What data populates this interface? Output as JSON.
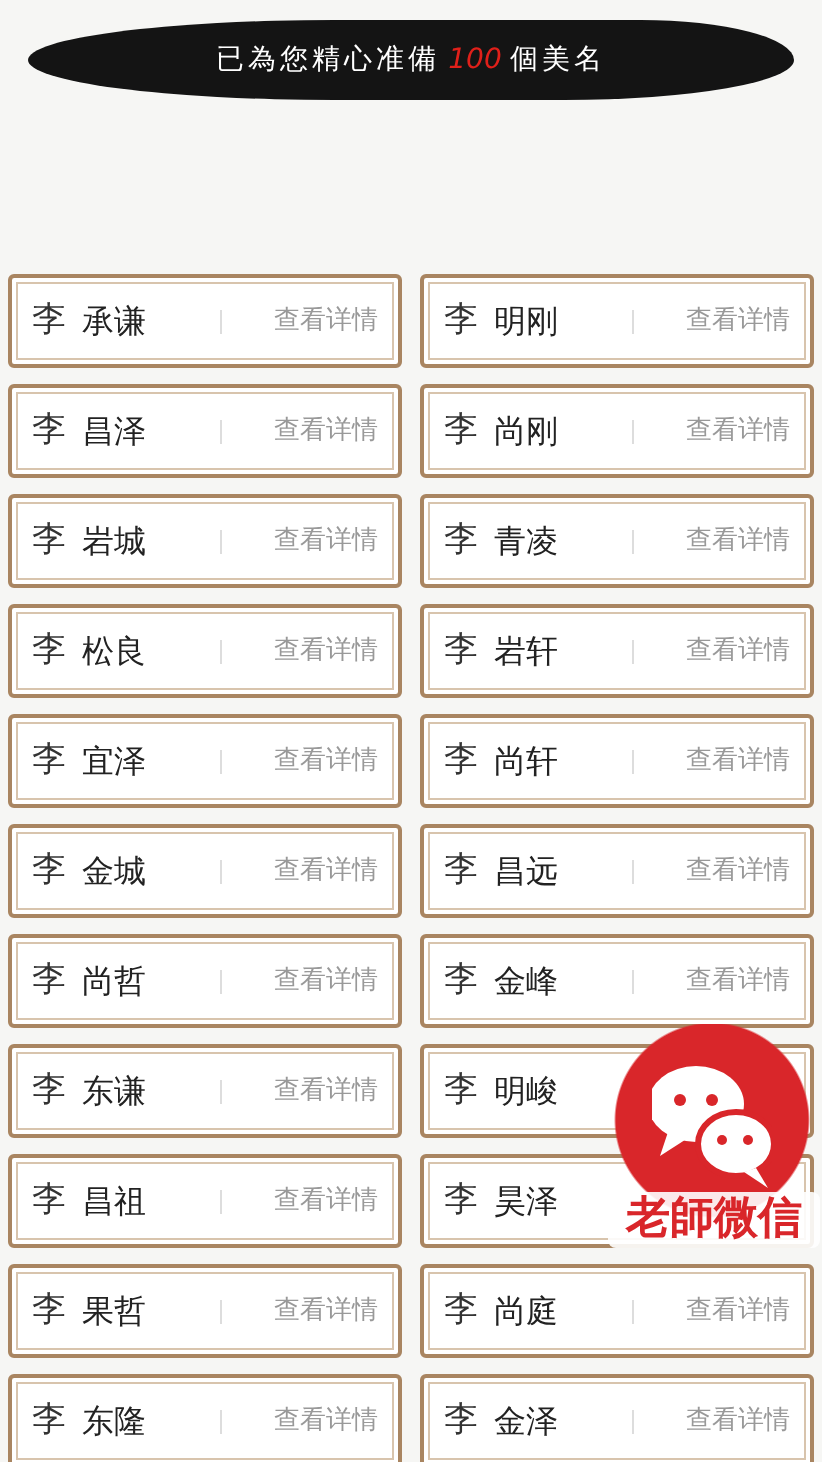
{
  "banner": {
    "before": "已為您精心准備",
    "count": "100",
    "after": "個美名"
  },
  "names": [
    {
      "surname": "李",
      "given": "承谦",
      "detail": "查看详情"
    },
    {
      "surname": "李",
      "given": "明刚",
      "detail": "查看详情"
    },
    {
      "surname": "李",
      "given": "昌泽",
      "detail": "查看详情"
    },
    {
      "surname": "李",
      "given": "尚刚",
      "detail": "查看详情"
    },
    {
      "surname": "李",
      "given": "岩城",
      "detail": "查看详情"
    },
    {
      "surname": "李",
      "given": "青凌",
      "detail": "查看详情"
    },
    {
      "surname": "李",
      "given": "松良",
      "detail": "查看详情"
    },
    {
      "surname": "李",
      "given": "岩轩",
      "detail": "查看详情"
    },
    {
      "surname": "李",
      "given": "宜泽",
      "detail": "查看详情"
    },
    {
      "surname": "李",
      "given": "尚轩",
      "detail": "查看详情"
    },
    {
      "surname": "李",
      "given": "金城",
      "detail": "查看详情"
    },
    {
      "surname": "李",
      "given": "昌远",
      "detail": "查看详情"
    },
    {
      "surname": "李",
      "given": "尚哲",
      "detail": "查看详情"
    },
    {
      "surname": "李",
      "given": "金峰",
      "detail": "查看详情"
    },
    {
      "surname": "李",
      "given": "东谦",
      "detail": "查看详情"
    },
    {
      "surname": "李",
      "given": "明峻"
    },
    {
      "surname": "李",
      "given": "昌祖",
      "detail": "查看详情"
    },
    {
      "surname": "李",
      "given": "昊泽"
    },
    {
      "surname": "李",
      "given": "果哲",
      "detail": "查看详情"
    },
    {
      "surname": "李",
      "given": "尚庭",
      "detail": "查看详情"
    },
    {
      "surname": "李",
      "given": "东隆",
      "detail": "查看详情"
    },
    {
      "surname": "李",
      "given": "金泽",
      "detail": "查看详情"
    }
  ],
  "contact_button": {
    "label": "老師微信"
  }
}
